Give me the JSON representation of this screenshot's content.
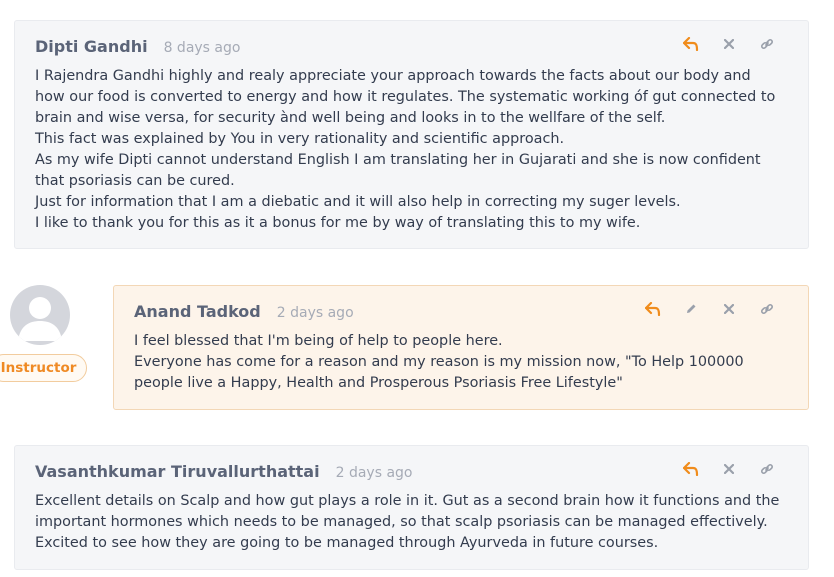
{
  "colors": {
    "accent": "#f08c1c",
    "icon_gray": "#9aa0ab",
    "card_bg": "#f5f6f8",
    "instructor_bg": "#fdf4ea"
  },
  "comments": [
    {
      "author": "Dipti Gandhi",
      "time": "8 days ago",
      "lines": [
        "I Rajendra Gandhi highly and realy appreciate your approach towards the facts about our body and",
        "how our food is converted to energy and how it regulates. The systematic working óf gut connected to",
        "brain and wise versa, for security ànd well being and looks in to the wellfare of the self.",
        "This fact was explained by You in very rationality and scientific approach.",
        "As my wife Dipti cannot understand English I am translating her in Gujarati and she is now confident",
        "that psoriasis can be cured.",
        "Just for information that I am a diebatic and it will also help in correcting my suger levels.",
        "I like to thank you for this as it a bonus for me by way of translating this to my wife."
      ]
    },
    {
      "author": "Anand Tadkod",
      "time": "2 days ago",
      "badge": "Instructor",
      "lines": [
        "I feel blessed that I'm being of help to people here.",
        "Everyone has come for a reason and my reason is my mission now, \"To Help 100000",
        "people live a Happy, Health and Prosperous Psoriasis Free Lifestyle\""
      ]
    },
    {
      "author": "Vasanthkumar Tiruvallurthattai",
      "time": "2 days ago",
      "lines": [
        "Excellent details on Scalp and how gut plays a role in it. Gut as a second brain how it functions and the",
        "important hormones which needs to be managed, so that scalp psoriasis can be managed effectively.",
        "Excited to see how they are going to be managed through Ayurveda in future courses."
      ]
    }
  ],
  "icons": {
    "reply": "reply-icon",
    "edit": "pencil-icon",
    "delete": "close-icon",
    "link": "link-icon",
    "avatar": "user-avatar-icon"
  }
}
